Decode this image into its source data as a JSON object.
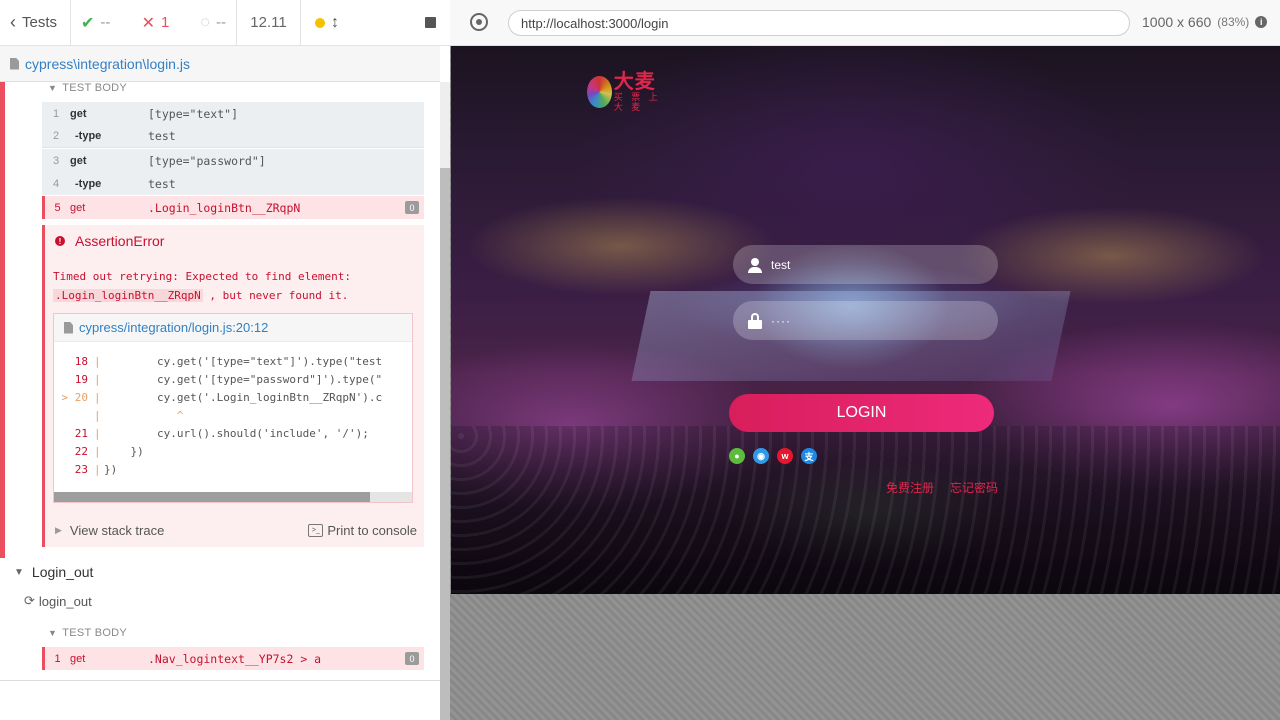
{
  "reporter": {
    "header": {
      "tests_label": "Tests",
      "passed": "--",
      "failed": "1",
      "pending": "--",
      "duration": "12.11"
    },
    "spec_path": "cypress\\integration\\login.js",
    "test_body_label": "TEST BODY",
    "commands": [
      {
        "num": "1",
        "name": "get",
        "message": "[type=\"text\"]"
      },
      {
        "num": "2",
        "name": "-type",
        "message": "test"
      },
      {
        "num": "3",
        "name": "get",
        "message": "[type=\"password\"]"
      },
      {
        "num": "4",
        "name": "-type",
        "message": "test"
      },
      {
        "num": "5",
        "name": "get",
        "message": ".Login_loginBtn__ZRqpN",
        "badge": "0"
      }
    ],
    "error": {
      "title": "AssertionError",
      "message_pre": "Timed out retrying: Expected to find element:",
      "message_code": ".Login_loginBtn__ZRqpN",
      "message_post": ", but never found it.",
      "file_link": "cypress/integration/login.js:20:12",
      "code_lines": [
        {
          "ln": "18",
          "code": "        cy.get('[type=\"text\"]').type(\"test"
        },
        {
          "ln": "19",
          "code": "        cy.get('[type=\"password\"]').type(\""
        },
        {
          "ln": "> 20",
          "code": "        cy.get('.Login_loginBtn__ZRqpN').c"
        },
        {
          "ln": "",
          "code": "           ^"
        },
        {
          "ln": "21",
          "code": "        cy.url().should('include', '/');"
        },
        {
          "ln": "22",
          "code": "    })"
        },
        {
          "ln": "23",
          "code": "})"
        }
      ],
      "view_stack_trace": "View stack trace",
      "print_to_console": "Print to console"
    },
    "suite2": {
      "title": "Login_out",
      "test_title": "login_out",
      "test_body_label": "TEST BODY",
      "command": {
        "num": "1",
        "name": "get",
        "message": ".Nav_logintext__YP7s2 > a",
        "badge": "0"
      }
    }
  },
  "aut": {
    "url": "http://localhost:3000/login",
    "viewport": "1000 x 660",
    "scale": "(83%)",
    "app": {
      "logo_text": "大麦",
      "logo_sub": "买 票 上 大 麦",
      "username_value": "test",
      "password_value": "····",
      "login_button": "LOGIN",
      "register_link": "免费注册",
      "forgot_link": "忘记密码",
      "social_icons": [
        "wechat-icon",
        "qq-icon",
        "weibo-icon",
        "alipay-icon"
      ]
    }
  }
}
